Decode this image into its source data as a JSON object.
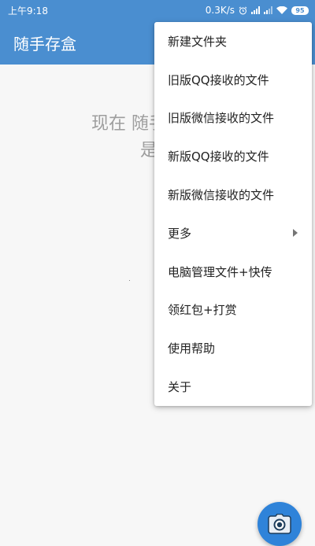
{
  "status_bar": {
    "time": "上午9:18",
    "network_speed": "0.3K/s",
    "battery": "95",
    "icons": [
      "alarm-icon",
      "signal-icon",
      "signal-icon",
      "wifi-icon",
      "battery-icon"
    ]
  },
  "app_bar": {
    "title": "随手存盒"
  },
  "empty_state": {
    "line1": "现在 随手存盒 里",
    "line2": "是空"
  },
  "menu": {
    "items": [
      {
        "label": "新建文件夹"
      },
      {
        "label": "旧版QQ接收的文件"
      },
      {
        "label": "旧版微信接收的文件"
      },
      {
        "label": "新版QQ接收的文件"
      },
      {
        "label": "新版微信接收的文件"
      },
      {
        "label": "更多",
        "has_submenu": true
      },
      {
        "label": "电脑管理文件+快传"
      },
      {
        "label": "领红包+打赏"
      },
      {
        "label": "使用帮助"
      },
      {
        "label": "关于"
      }
    ]
  },
  "fab": {
    "icon": "camera-icon"
  },
  "colors": {
    "primary": "#4a8ed0",
    "fab": "#2f83d9",
    "background": "#f7f7f7",
    "empty_text": "#9e9e9e"
  }
}
